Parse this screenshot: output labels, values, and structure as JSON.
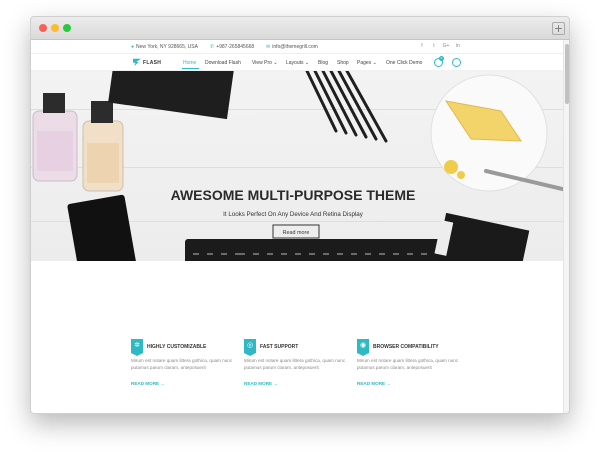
{
  "topbar": {
    "address": "New York, NY 928665, USA",
    "phone": "+987-265845668",
    "email": "info@themegrill.com",
    "social": [
      "f",
      "t",
      "G+",
      "in"
    ]
  },
  "brand": {
    "name": "FLASH"
  },
  "nav": {
    "items": [
      "Home",
      "Download Flash",
      "View Pro",
      "Layouts",
      "Blog",
      "Shop",
      "Pages",
      "One Click Demo"
    ],
    "chevron": "⌄"
  },
  "cart": {
    "count": "0"
  },
  "hero": {
    "title": "AWESOME MULTI-PURPOSE THEME",
    "subtitle": "It Looks Perfect On Any Device And Retina Display",
    "button": "Read more"
  },
  "features": [
    {
      "title": "HIGHLY CUSTOMIZABLE",
      "text": "Mirum est notare quam littera gothica, quam nunc putamus parum claram, anteposuerit",
      "more": "READ MORE →",
      "icon": "gear-icon"
    },
    {
      "title": "FAST SUPPORT",
      "text": "Mirum est notare quam littera gothica, quam nunc putamus parum claram, anteposuerit",
      "more": "READ MORE →",
      "icon": "globe-icon"
    },
    {
      "title": "BROWSER COMPATIBILITY",
      "text": "Mirum est notare quam littera gothica, quam nunc putamus parum claram, anteposuerit",
      "more": "READ MORE →",
      "icon": "browser-icon"
    }
  ],
  "colors": {
    "accent": "#2fb9c4",
    "text": "#333333"
  }
}
